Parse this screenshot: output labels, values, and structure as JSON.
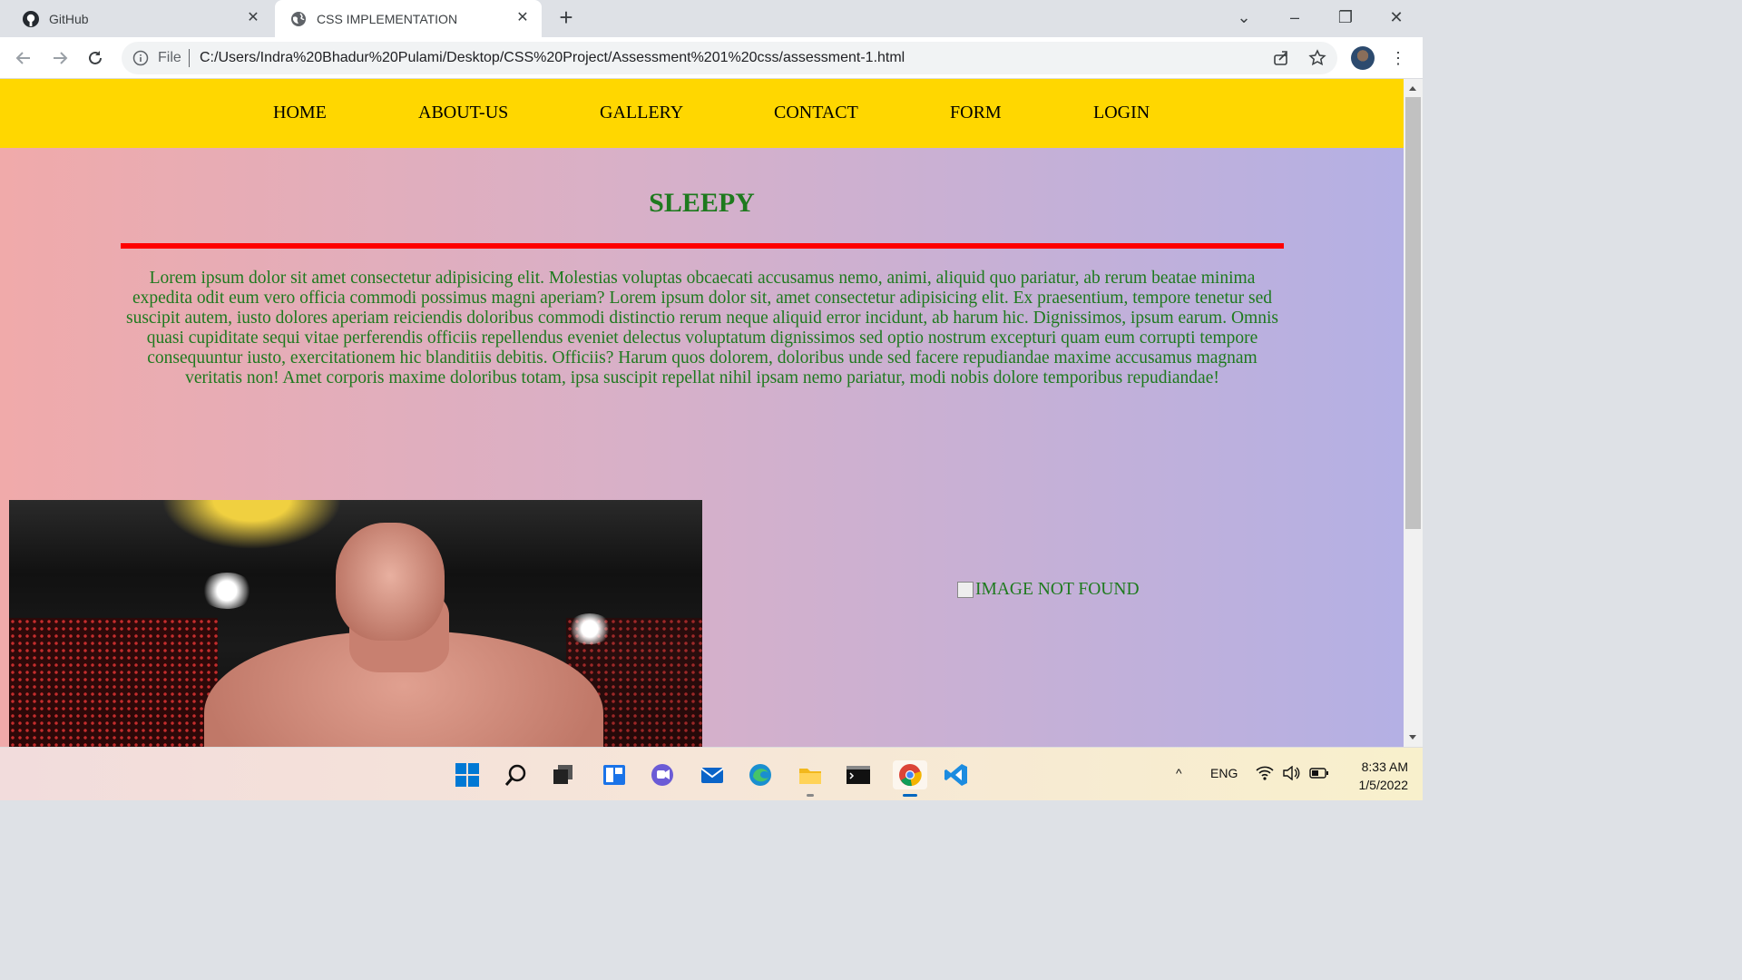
{
  "browser": {
    "tabs": [
      {
        "title": "GitHub",
        "icon": "github-icon",
        "active": false
      },
      {
        "title": "CSS IMPLEMENTATION",
        "icon": "globe-icon",
        "active": true
      }
    ],
    "new_tab_symbol": "+",
    "omnibox": {
      "scheme_label": "File",
      "url": "C:/Users/Indra%20Bhadur%20Pulami/Desktop/CSS%20Project/Assessment%201%20css/assessment-1.html"
    }
  },
  "page": {
    "nav": [
      "HOME",
      "ABOUT-US",
      "GALLERY",
      "CONTACT",
      "FORM",
      "LOGIN"
    ],
    "heading": "SLEEPY",
    "paragraph": "Lorem ipsum dolor sit amet consectetur adipisicing elit. Molestias voluptas obcaecati accusamus nemo, animi, aliquid quo pariatur, ab rerum beatae minima expedita odit eum vero officia commodi possimus magni aperiam? Lorem ipsum dolor sit, amet consectetur adipisicing elit. Ex praesentium, tempore tenetur sed suscipit autem, iusto dolores aperiam reiciendis doloribus commodi distinctio rerum neque aliquid error incidunt, ab harum hic. Dignissimos, ipsum earum. Omnis quasi cupiditate sequi vitae perferendis officiis repellendus eveniet delectus voluptatum dignissimos sed optio nostrum excepturi quam eum corrupti tempore consequuntur iusto, exercitationem hic blanditiis debitis. Officiis? Harum quos dolorem, doloribus unde sed facere repudiandae maxime accusamus magnam veritatis non! Amet corporis maxime doloribus totam, ipsa suscipit repellat nihil ipsam nemo pariatur, modi nobis dolore temporibus repudiandae!",
    "broken_image_alt": "IMAGE NOT FOUND",
    "colors": {
      "nav_bg": "#ffd700",
      "text_green": "#1e7a1e",
      "rule_red": "#ff0000"
    }
  },
  "taskbar": {
    "apps": [
      "windows-start-icon",
      "search-icon",
      "task-view-icon",
      "widgets-icon",
      "chat-icon",
      "mail-icon",
      "edge-icon",
      "file-explorer-icon",
      "terminal-icon",
      "chrome-icon",
      "vscode-icon"
    ],
    "language": "ENG",
    "time": "8:33 AM",
    "date": "1/5/2022"
  }
}
